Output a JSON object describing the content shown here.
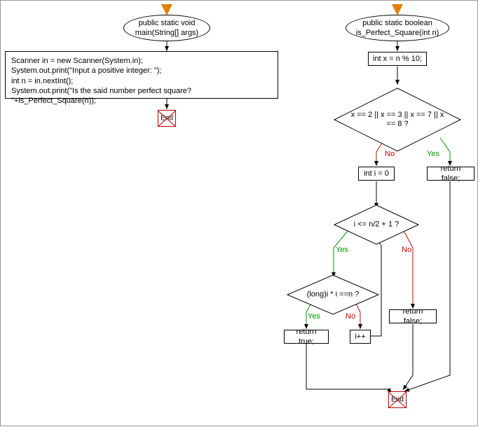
{
  "flowchart_left": {
    "start_marker": "start",
    "method_signature": "public static void\nmain(String[] args)",
    "body": "Scanner in = new Scanner(System.in);\nSystem.out.print(\"Input a positive integer: \");\nint n = in.nextInt();\nSystem.out.print(\"Is the said number perfect square? \"+is_Perfect_Square(n));",
    "end": "End"
  },
  "flowchart_right": {
    "start_marker": "start",
    "method_signature": "public static boolean\nis_Perfect_Square(int n)",
    "stmt_x": "int x = n % 10;",
    "cond1": "x == 2 || x == 3 || x ==\n7 || x == 8 ?",
    "cond1_yes": "Yes",
    "cond1_no": "No",
    "return_false_top": "return false;",
    "stmt_i": "int i = 0",
    "cond2": "i <= n/2 + 1 ?",
    "cond2_yes": "Yes",
    "cond2_no": "No",
    "cond3": "(long)i * i ==n ?",
    "cond3_yes": "Yes",
    "cond3_no": "No",
    "return_true": "return true;",
    "inc": "i++",
    "return_false_bottom": "return false;",
    "end": "End"
  },
  "colors": {
    "yes": "#009900",
    "no": "#cc0000",
    "end_border": "#bb0000",
    "arrow_start": "#e08000"
  }
}
